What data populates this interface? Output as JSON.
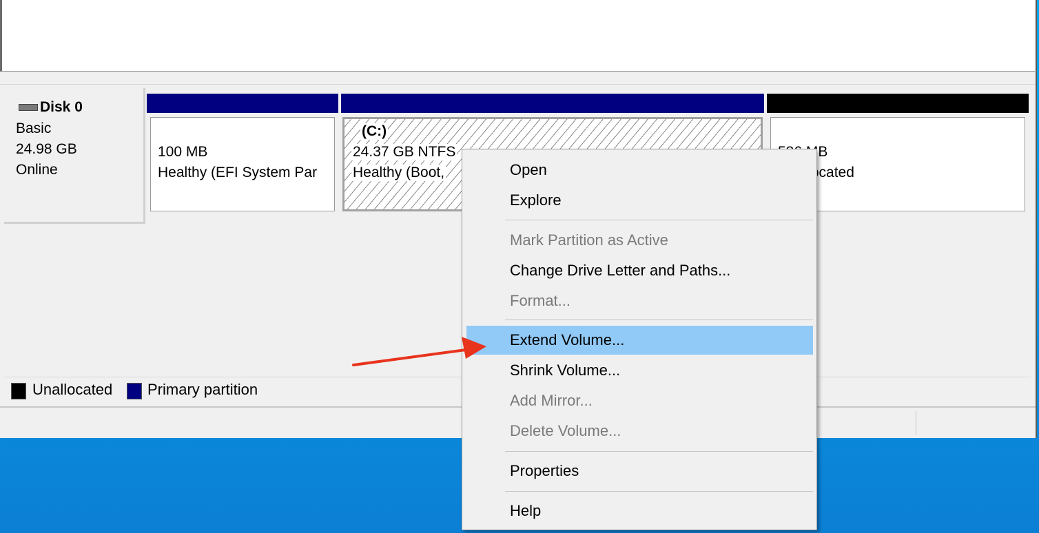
{
  "colors": {
    "primary_partition": "#000080",
    "unallocated": "#000000",
    "menu_highlight": "#91c9f7",
    "annotation_arrow": "#e8331d"
  },
  "disk": {
    "icon": "disk-drive-icon",
    "name": "Disk 0",
    "type": "Basic",
    "size": "24.98 GB",
    "status": "Online"
  },
  "partitions": [
    {
      "line1": "",
      "line2": "100 MB",
      "line3": "Healthy (EFI System Par",
      "kind": "Primary partition"
    },
    {
      "line1": "(C:)",
      "line2": "24.37 GB NTFS",
      "line3": "Healthy (Boot,",
      "kind": "Primary partition"
    },
    {
      "line1": "",
      "line2": "536 MB",
      "line3": "Unallocated",
      "kind": "Unallocated"
    }
  ],
  "legend": {
    "items": [
      {
        "label": "Unallocated",
        "color": "#000000"
      },
      {
        "label": "Primary partition",
        "color": "#000080"
      }
    ]
  },
  "context_menu": {
    "items": [
      {
        "label": "Open",
        "enabled": true
      },
      {
        "label": "Explore",
        "enabled": true
      },
      {
        "label": "Mark Partition as Active",
        "enabled": false
      },
      {
        "label": "Change Drive Letter and Paths...",
        "enabled": true
      },
      {
        "label": "Format...",
        "enabled": false
      },
      {
        "label": "Extend Volume...",
        "enabled": true,
        "highlighted": true
      },
      {
        "label": "Shrink Volume...",
        "enabled": true
      },
      {
        "label": "Add Mirror...",
        "enabled": false
      },
      {
        "label": "Delete Volume...",
        "enabled": false
      },
      {
        "label": "Properties",
        "enabled": true
      },
      {
        "label": "Help",
        "enabled": true
      }
    ]
  }
}
